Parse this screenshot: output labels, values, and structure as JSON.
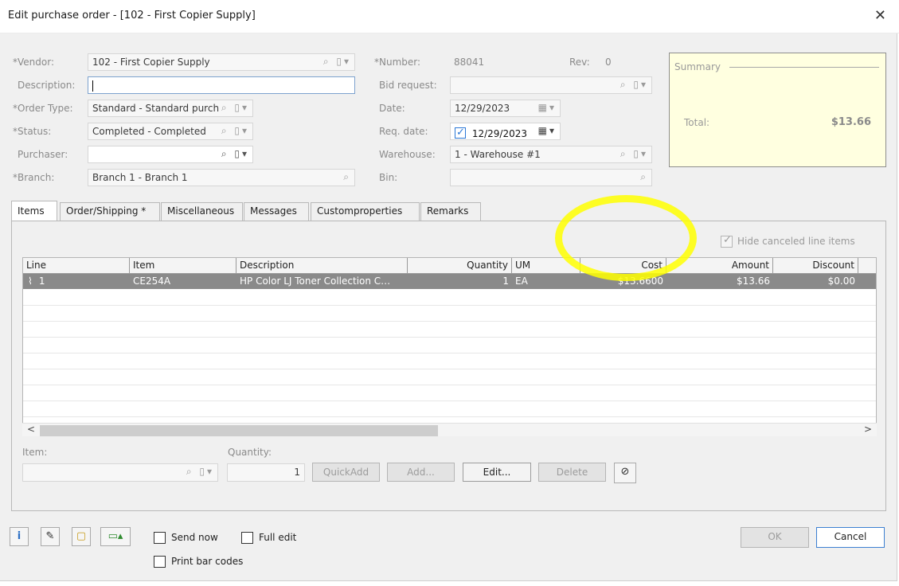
{
  "window": {
    "title": "Edit purchase order - [102 - First Copier Supply]",
    "close_glyph": "✕"
  },
  "header": {
    "vendor_label": "*Vendor:",
    "vendor_value": "102 - First Copier Supply",
    "description_label": "Description:",
    "description_value": "",
    "order_type_label": "*Order Type:",
    "order_type_value": "Standard - Standard purch",
    "status_label": "*Status:",
    "status_value": "Completed - Completed",
    "purchaser_label": "Purchaser:",
    "purchaser_value": "",
    "branch_label": "*Branch:",
    "branch_value": "Branch 1 - Branch 1",
    "number_label": "*Number:",
    "number_value": "88041",
    "rev_label": "Rev:",
    "rev_value": "0",
    "bid_request_label": "Bid request:",
    "bid_request_value": "",
    "date_label": "Date:",
    "date_value": "12/29/2023",
    "req_date_label": "Req. date:",
    "req_date_value": "12/29/2023",
    "warehouse_label": "Warehouse:",
    "warehouse_value": "1 - Warehouse #1",
    "bin_label": "Bin:",
    "bin_value": ""
  },
  "summary": {
    "heading": "Summary",
    "total_label": "Total:",
    "total_value": "$13.66"
  },
  "tabs": [
    "Items",
    "Order/Shipping *",
    "Miscellaneous",
    "Messages",
    "Customproperties",
    "Remarks"
  ],
  "items": {
    "hide_canceled_label": "Hide canceled line items",
    "hide_canceled_checked": true,
    "columns": [
      "Line",
      "Item",
      "Description",
      "Quantity",
      "UM",
      "Cost",
      "Amount",
      "Discount"
    ],
    "rows": [
      {
        "line": "1",
        "item": "CE254A",
        "description": "HP Color LJ Toner Collection C…",
        "quantity": "1",
        "um": "EA",
        "cost": "$13.6600",
        "amount": "$13.66",
        "discount": "$0.00"
      }
    ],
    "item_label": "Item:",
    "quantity_label": "Quantity:",
    "quantity_value": "1",
    "quickadd_label": "QuickAdd",
    "add_label": "Add...",
    "edit_label": "Edit...",
    "delete_label": "Delete"
  },
  "footer": {
    "send_now_label": "Send now",
    "full_edit_label": "Full edit",
    "print_bar_codes_label": "Print bar codes",
    "ok_label": "OK",
    "cancel_label": "Cancel"
  },
  "colors": {
    "selected_row": "#8a8a8a",
    "summary_bg": "#ffffe0",
    "highlight": "#ffff00",
    "accent": "#3c7fd1"
  }
}
